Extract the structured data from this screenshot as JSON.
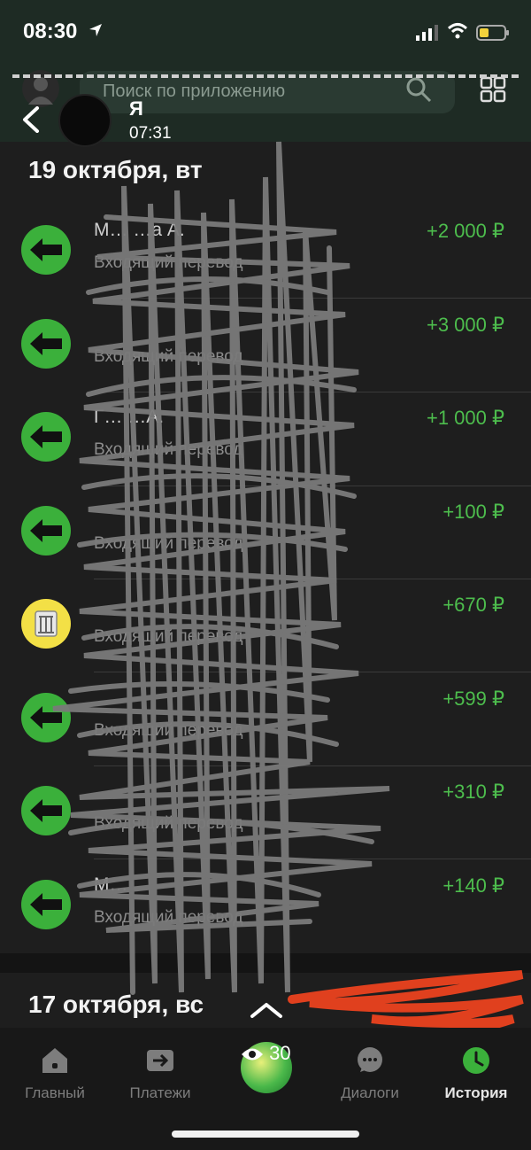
{
  "status_bar": {
    "time": "08:30"
  },
  "search": {
    "placeholder": "Поиск по приложению"
  },
  "story": {
    "name": "Я",
    "time": "07:31",
    "views": "30"
  },
  "sections": [
    {
      "date": "19 октября, вт",
      "transactions": [
        {
          "title": "М…                …а А.",
          "subtitle": "Входящий перевод",
          "amount": "+2 000 ₽",
          "icon": "incoming-arrow-icon"
        },
        {
          "title": "",
          "subtitle": "Входящий перевод",
          "amount": "+3 000 ₽",
          "icon": "incoming-arrow-icon"
        },
        {
          "title": "Г…                …А.",
          "subtitle": "Входящий перевод",
          "amount": "+1 000 ₽",
          "icon": "incoming-arrow-icon"
        },
        {
          "title": "",
          "subtitle": "Входящий перевод",
          "amount": "+100 ₽",
          "icon": "incoming-arrow-icon"
        },
        {
          "title": "",
          "subtitle": "Входящий перевод",
          "amount": "+670 ₽",
          "icon": "bank-logo-icon"
        },
        {
          "title": "",
          "subtitle": "Входящий перевод",
          "amount": "+599 ₽",
          "icon": "incoming-arrow-icon"
        },
        {
          "title": "",
          "subtitle": "Входящий перевод",
          "amount": "+310 ₽",
          "icon": "incoming-arrow-icon"
        },
        {
          "title": "М…",
          "subtitle": "Входящий перевод",
          "amount": "+140 ₽",
          "icon": "incoming-arrow-icon"
        }
      ]
    },
    {
      "date": "17 октября, вс"
    }
  ],
  "tabs": [
    {
      "label": "Главный",
      "icon": "home-icon",
      "active": false
    },
    {
      "label": "Платежи",
      "icon": "payments-icon",
      "active": false
    },
    {
      "label": "Диалоги",
      "icon": "chat-icon",
      "active": false
    },
    {
      "label": "История",
      "icon": "clock-icon",
      "active": true
    }
  ],
  "colors": {
    "accent_green": "#4dbd4d",
    "icon_green": "#3bb03b",
    "background": "#1e1e1e",
    "scribble": "#7a7a7a",
    "redaction_red": "#e0401e"
  }
}
